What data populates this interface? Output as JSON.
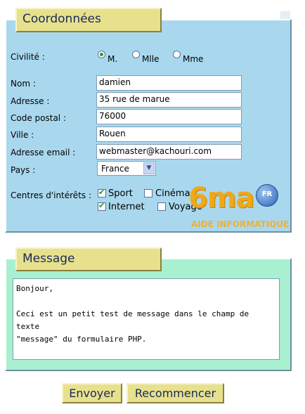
{
  "coordonnees": {
    "legend": "Coordonnées",
    "civilite": {
      "label": "Civilité :",
      "options": [
        "M.",
        "Mlle",
        "Mme"
      ],
      "selected": "M."
    },
    "nom": {
      "label": "Nom :",
      "value": "damien"
    },
    "adresse": {
      "label": "Adresse :",
      "value": "35 rue de marue"
    },
    "code_postal": {
      "label": "Code postal :",
      "value": "76000"
    },
    "ville": {
      "label": "Ville :",
      "value": "Rouen"
    },
    "email": {
      "label": "Adresse email :",
      "value": "webmaster@kachouri.com"
    },
    "pays": {
      "label": "Pays :",
      "value": "France"
    },
    "interets": {
      "label": "Centres d'intérêts :",
      "items": [
        {
          "label": "Sport",
          "checked": true
        },
        {
          "label": "Cinéma",
          "checked": false
        },
        {
          "label": "Internet",
          "checked": true
        },
        {
          "label": "Voyage",
          "checked": false
        }
      ]
    }
  },
  "message": {
    "legend": "Message",
    "text": "Bonjour,\n\nCeci est un petit test de message dans le champ de texte\n\"message\" du formulaire PHP."
  },
  "buttons": {
    "submit": "Envoyer",
    "reset": "Recommencer"
  },
  "watermark": {
    "logo": "6ma",
    "badge": "FR",
    "tagline": "AIDE INFORMATIQUE"
  },
  "colors": {
    "coord_bg": "#a9d8ee",
    "message_bg": "#a8f0d0",
    "legend_bg": "#e7e18e",
    "button_bg": "#e7e18e"
  }
}
